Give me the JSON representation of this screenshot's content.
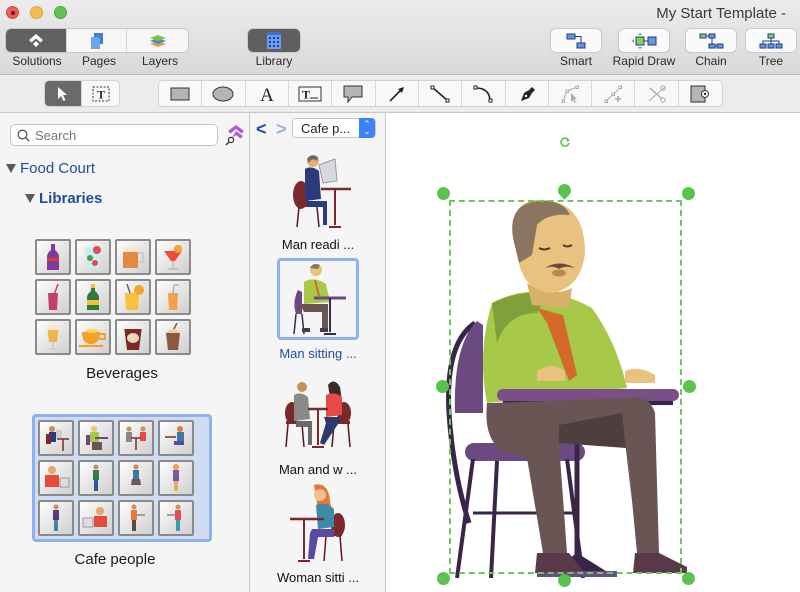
{
  "window": {
    "title": "My Start Template -",
    "controls": [
      "close",
      "minimize",
      "maximize"
    ]
  },
  "toolbar": {
    "left_segment": [
      {
        "label": "Solutions",
        "icon": "solutions-icon",
        "active": true
      },
      {
        "label": "Pages",
        "icon": "pages-icon",
        "active": false
      },
      {
        "label": "Layers",
        "icon": "layers-icon",
        "active": false
      }
    ],
    "library": {
      "label": "Library",
      "icon": "library-icon",
      "active": true
    },
    "right_buttons": [
      {
        "label": "Smart",
        "icon": "smart-connector-icon"
      },
      {
        "label": "Rapid Draw",
        "icon": "rapid-draw-icon"
      },
      {
        "label": "Chain",
        "icon": "chain-icon"
      },
      {
        "label": "Tree",
        "icon": "tree-icon"
      }
    ]
  },
  "drawing_tools": {
    "selection": [
      {
        "name": "pointer-tool",
        "active": true
      },
      {
        "name": "text-box-select-tool",
        "active": false
      }
    ],
    "shapes": [
      {
        "name": "rectangle-tool"
      },
      {
        "name": "ellipse-tool"
      },
      {
        "name": "text-tool",
        "glyph": "A"
      },
      {
        "name": "text-block-tool",
        "glyph": "T"
      },
      {
        "name": "callout-tool"
      },
      {
        "name": "arrow-tool"
      },
      {
        "name": "line-tool"
      },
      {
        "name": "arc-tool"
      },
      {
        "name": "pen-tool"
      },
      {
        "name": "edit-points-tool",
        "disabled": true
      },
      {
        "name": "add-point-tool",
        "disabled": true
      },
      {
        "name": "cut-path-tool",
        "disabled": true
      },
      {
        "name": "snapshot-tool"
      }
    ]
  },
  "sidebar": {
    "search": {
      "placeholder": "Search",
      "value": ""
    },
    "tree": {
      "root": "Food Court",
      "child": "Libraries"
    },
    "libraries": [
      {
        "label": "Beverages",
        "selected": false,
        "items": [
          "soda-bottle",
          "strawberry-drink",
          "beer-mug",
          "cocktail",
          "berry-juice",
          "champagne",
          "lemonade",
          "orange-juice",
          "latte",
          "tea-cup",
          "coffee-cup",
          "iced-coffee"
        ]
      },
      {
        "label": "Cafe people",
        "selected": true,
        "items": [
          "man-reading",
          "man-sitting",
          "couple",
          "woman-sitting",
          "cashier-man",
          "man-standing",
          "woman-walking",
          "woman-standing",
          "man-standing-2",
          "cashier-woman",
          "waiter",
          "waitress"
        ]
      }
    ]
  },
  "library_panel": {
    "back_label": "<",
    "forward_label": ">",
    "dropdown": {
      "value": "Cafe p..."
    },
    "items": [
      {
        "label": "Man readi ...",
        "selected": false
      },
      {
        "label": "Man sitting ...",
        "selected": true
      },
      {
        "label": "Man and w ...",
        "selected": false
      },
      {
        "label": "Woman sitti ...",
        "selected": false
      }
    ]
  },
  "canvas": {
    "selected_shape": "Man sitting",
    "colors": {
      "selection": "#5cc24e",
      "shirt": "#a8c84a",
      "chair": "#6b4a82",
      "pants": "#6a5555",
      "skin": "#e8c27e",
      "tie": "#d46a2a"
    }
  }
}
